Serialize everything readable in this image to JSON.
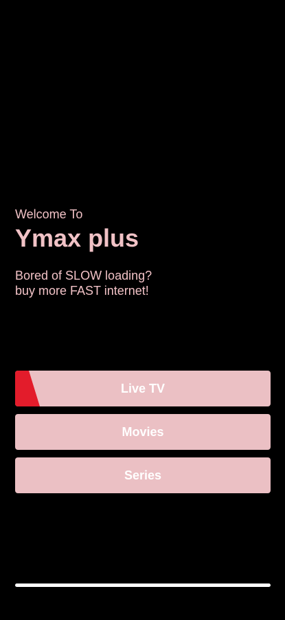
{
  "welcome": {
    "greeting": "Welcome To",
    "app_name": "Ymax plus",
    "tagline_line1": "Bored of SLOW loading?",
    "tagline_line2": "buy more FAST internet!"
  },
  "menu": {
    "items": [
      {
        "label": "Live TV"
      },
      {
        "label": "Movies"
      },
      {
        "label": "Series"
      }
    ],
    "selected_index": 0
  },
  "colors": {
    "background": "#000000",
    "text_pink": "#f1c2c6",
    "button_bg": "#ebc0c4",
    "accent_red": "#e31c2b",
    "button_text": "#ffffff"
  }
}
